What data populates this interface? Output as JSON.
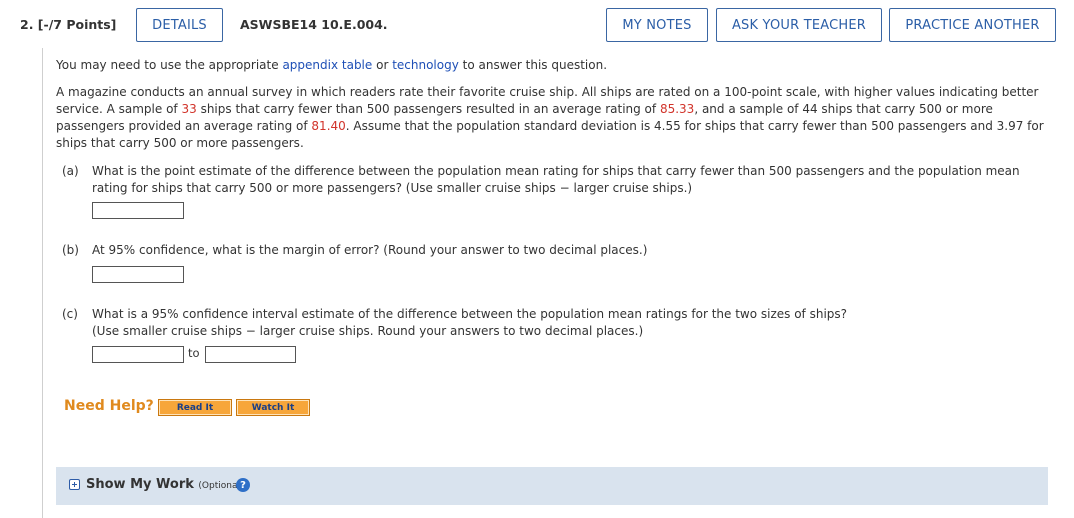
{
  "header": {
    "question": "2. [-/7 Points]",
    "details": "DETAILS",
    "code": "ASWSBE14 10.E.004.",
    "my_notes": "MY NOTES",
    "ask_teacher": "ASK YOUR TEACHER",
    "practice": "PRACTICE ANOTHER"
  },
  "intro": {
    "before": "You may need to use the appropriate ",
    "link1": "appendix table",
    "mid": " or ",
    "link2": "technology",
    "after": " to answer this question."
  },
  "problem": {
    "t1": "A magazine conducts an annual survey in which readers rate their favorite cruise ship. All ships are rated on a 100-point scale, with higher values indicating better service. A sample of ",
    "n1": "33",
    "t2": " ships that carry fewer than 500 passengers resulted in an average rating of ",
    "m1": "85.33",
    "t3": ", and a sample of 44 ships that carry 500 or more passengers provided an average rating of ",
    "m2": "81.40",
    "t4": ". Assume that the population standard deviation is 4.55 for ships that carry fewer than 500 passengers and 3.97 for ships that carry 500 or more passengers."
  },
  "parts": {
    "a_label": "(a)",
    "a_text": "What is the point estimate of the difference between the population mean rating for ships that carry fewer than 500 passengers and the population mean rating for ships that carry 500 or more passengers? (Use smaller cruise ships − larger cruise ships.)",
    "b_label": "(b)",
    "b_text": "At 95% confidence, what is the margin of error? (Round your answer to two decimal places.)",
    "c_label": "(c)",
    "c_text1": "What is a 95% confidence interval estimate of the difference between the population mean ratings for the two sizes of ships?",
    "c_text2": "(Use smaller cruise ships − larger cruise ships. Round your answers to two decimal places.)",
    "to": "to"
  },
  "help": {
    "label": "Need Help?",
    "read": "Read It",
    "watch": "Watch It"
  },
  "work": {
    "title": "Show My Work",
    "optional": "(Optional)",
    "help_glyph": "?"
  }
}
